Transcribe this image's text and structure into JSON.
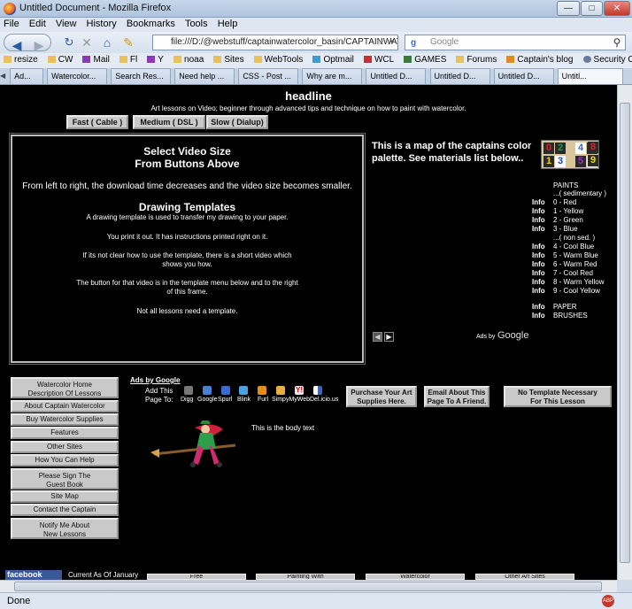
{
  "browser": {
    "title": "Untitled Document - Mozilla Firefox",
    "menu": [
      "File",
      "Edit",
      "View",
      "History",
      "Bookmarks",
      "Tools",
      "Help"
    ],
    "url": "file:///D:/@webstuff/captainwatercolor_basin/CAPTAINWATE",
    "search_placeholder": "Google",
    "bookmarks": [
      "resize",
      "CW",
      "Mail",
      "Fl",
      "Y",
      "noaa",
      "Sites",
      "WebTools",
      "Optmail",
      "WCL",
      "GAMES",
      "Forums",
      "Captain's blog",
      "Security Cleanup foru..."
    ],
    "tabs": [
      "Ad...",
      "Watercolor...",
      "Search Res...",
      "Need help ...",
      "CSS - Post ...",
      "Why are m...",
      "Untitled D...",
      "Untitled D...",
      "Untitled D...",
      "Untitl..."
    ],
    "status": "Done"
  },
  "page": {
    "headline": "headline",
    "subtitle": "Art lessons on Video; beginner through advanced tips and technique on how to paint with watercolor.",
    "speed_buttons": [
      "Fast ( Cable )",
      "Medium ( DSL )",
      "Slow ( Dialup)"
    ],
    "frame": {
      "h1": "Select Video Size",
      "h2": "From Buttons Above",
      "p1": "From left to right, the download time decreases and the video size becomes smaller.",
      "h3": "Drawing Templates",
      "p2": "A drawing template is used to transfer my drawing to your paper.",
      "p3": "You print it out. It has instructions printed right on it.",
      "p4a": "If its not clear how to use the template, there is a short video which",
      "p4b": "shows you how.",
      "p5a": "The button for that video is in the template menu below and to the right",
      "p5b": "of this frame.",
      "p6": "Not all lessons need a template."
    },
    "map_text": "This is a map of the captains color palette. See materials list below..",
    "palette": {
      "top": [
        "0",
        "2",
        "4",
        "6",
        "8"
      ],
      "bottom": [
        "1",
        "3",
        "5",
        "7",
        "9"
      ]
    },
    "paints_title": "PAINTS",
    "sedimentary": "...( sedimentary )",
    "non_sed": "...( non sed. )",
    "info": "Info",
    "colors": [
      "0 - Red",
      "1 - Yellow",
      "2 - Green",
      "3 - Blue",
      "4 - Cool Blue",
      "5 - Warm Blue",
      "6 - Warm Red",
      "7 - Cool Red",
      "8 - Warm Yellow",
      "9 - Cool Yellow"
    ],
    "paper": "PAPER",
    "brushes": "BRUSHES",
    "ads_by": "Ads by",
    "google": "Google",
    "ads_by_google": "Ads by Google",
    "add_this": "Add This",
    "page_to": "Page To:",
    "share": [
      "Digg",
      "Google",
      "Spurl",
      "Blink",
      "Furl",
      "SimpyMyWeb",
      "Del.icio.us"
    ],
    "action_buttons": [
      "Purchase Your Art Supplies Here.",
      "Email About This Page To A Friend.",
      "No Template Necessary For This Lesson"
    ],
    "body_text": "This is the body text",
    "nav": [
      "Watercolor Home",
      "Description Of Lessons",
      "About Captain Watercolor",
      "Buy Watercolor Supplies",
      "Features",
      "Other Sites",
      "How You Can Help",
      "Please Sign The",
      "Guest Book",
      "Site Map",
      "Contact the Captain",
      "Notify Me About",
      "New Lessons"
    ],
    "facebook": "facebook",
    "current_as_of": "Current As Of January",
    "footer_tabs": [
      "Free",
      "Painting With",
      "Watercolor",
      "Other Art Sites"
    ]
  },
  "colors": {
    "red": "#e0202a",
    "yellow": "#f2d21e",
    "green": "#1e9e3a",
    "blue": "#2040c8",
    "purple": "#a030c0"
  }
}
